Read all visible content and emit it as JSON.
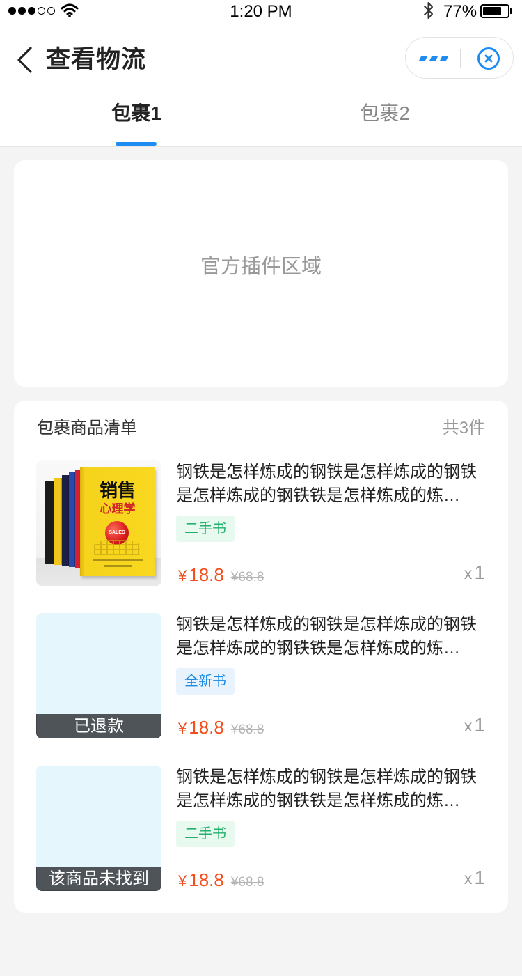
{
  "status_bar": {
    "time": "1:20 PM",
    "battery_label": "77%",
    "battery_level": 0.77,
    "signal_strength": 3,
    "signal_max": 5,
    "icons": {
      "signal": "signal-dots-icon",
      "wifi": "wifi-icon",
      "bluetooth": "bluetooth-icon",
      "battery": "battery-icon"
    }
  },
  "nav": {
    "title": "查看物流",
    "back_icon": "chevron-left-icon",
    "more_icon": "more-dashes-icon",
    "close_icon": "close-circle-icon"
  },
  "tabs": [
    {
      "label": "包裹1",
      "active": true
    },
    {
      "label": "包裹2",
      "active": false
    }
  ],
  "plugin_area": {
    "label": "官方插件区域"
  },
  "package": {
    "title": "包裹商品清单",
    "count_label": "共3件",
    "items": [
      {
        "title": "钢铁是怎样炼成的钢铁是怎样炼成的钢铁是怎样炼成的钢铁铁是怎样炼成的炼…",
        "tag": "二手书",
        "tag_color": "#22B26C",
        "tag_bg": "#E8F9EF",
        "currency": "¥",
        "price": "18.8",
        "original_price": "¥68.8",
        "quantity_prefix": "x",
        "quantity": "1",
        "cover_title": "销售",
        "cover_subtitle": "心理学",
        "cover_apple_text": "SALES"
      },
      {
        "title": "钢铁是怎样炼成的钢铁是怎样炼成的钢铁是怎样炼成的钢铁铁是怎样炼成的炼…",
        "tag": "全新书",
        "tag_color": "#1A8AE6",
        "tag_bg": "#E8F3FD",
        "currency": "¥",
        "price": "18.8",
        "original_price": "¥68.8",
        "quantity_prefix": "x",
        "quantity": "1",
        "status_overlay": "已退款"
      },
      {
        "title": "钢铁是怎样炼成的钢铁是怎样炼成的钢铁是怎样炼成的钢铁铁是怎样炼成的炼…",
        "tag": "二手书",
        "tag_color": "#22B26C",
        "tag_bg": "#E8F9EF",
        "currency": "¥",
        "price": "18.8",
        "original_price": "¥68.8",
        "quantity_prefix": "x",
        "quantity": "1",
        "status_overlay": "该商品未找到"
      }
    ]
  },
  "colors": {
    "accent": "#1E8CF0",
    "bg": "#F4F4F4",
    "price": "#F24E1E",
    "text": "#222222",
    "muted": "#999999",
    "placeholder": "#E5F6FD",
    "overlay": "#4F5459"
  }
}
